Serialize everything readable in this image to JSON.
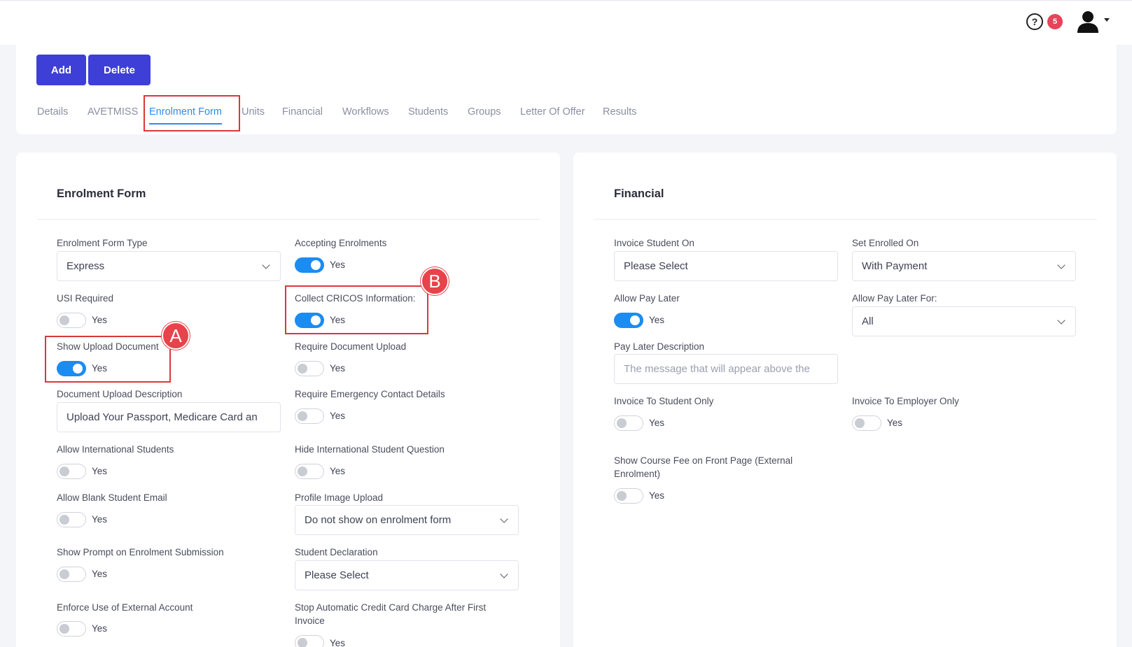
{
  "topbar": {
    "help_icon": "?",
    "notification_count": "5",
    "avatar_icon": "user-icon"
  },
  "toolbar": {
    "add_label": "Add",
    "delete_label": "Delete"
  },
  "tabs": [
    "Details",
    "AVETMISS",
    "Enrolment Form",
    "Units",
    "Financial",
    "Workflows",
    "Students",
    "Groups",
    "Letter Of Offer",
    "Results"
  ],
  "active_tab": "Enrolment Form",
  "enrolment": {
    "title": "Enrolment Form",
    "form_type_label": "Enrolment Form Type",
    "form_type_value": "Express",
    "accepting_label": "Accepting Enrolments",
    "usi_label": "USI Required",
    "cricos_label": "Collect CRICOS Information:",
    "show_upload_label": "Show Upload Document",
    "require_upload_label": "Require Document Upload",
    "upload_desc_label": "Document Upload Description",
    "upload_desc_value": "Upload Your Passport, Medicare Card an",
    "emergency_label": "Require Emergency Contact Details",
    "intl_label": "Allow International Students",
    "hide_intl_label": "Hide International Student Question",
    "blank_email_label": "Allow Blank Student Email",
    "profile_img_label": "Profile Image Upload",
    "profile_img_value": "Do not show on enrolment form",
    "prompt_label": "Show Prompt on Enrolment Submission",
    "declaration_label": "Student Declaration",
    "declaration_value": "Please Select",
    "external_label": "Enforce Use of External Account",
    "stop_charge_label": "Stop Automatic Credit Card Charge After First Invoice",
    "yes": "Yes"
  },
  "financial": {
    "title": "Financial",
    "invoice_on_label": "Invoice Student On",
    "invoice_on_value": "Please Select",
    "set_enrolled_label": "Set Enrolled On",
    "set_enrolled_value": "With Payment",
    "pay_later_label": "Allow Pay Later",
    "pay_later_for_label": "Allow Pay Later For:",
    "pay_later_for_value": "All",
    "pay_later_desc_label": "Pay Later Description",
    "pay_later_desc_placeholder": "The message that will appear above the",
    "invoice_student_only_label": "Invoice To Student Only",
    "invoice_employer_only_label": "Invoice To Employer Only",
    "show_fee_label": "Show Course Fee on Front Page (External Enrolment)",
    "yes": "Yes"
  },
  "annotations": {
    "marker_a": "A",
    "marker_b": "B"
  },
  "colors": {
    "primary_button": "#3e3fd7",
    "toggle_on": "#1b8cf2",
    "active_tab": "#2d8cf0",
    "highlight": "#d9383a",
    "badge": "#e8435b"
  }
}
